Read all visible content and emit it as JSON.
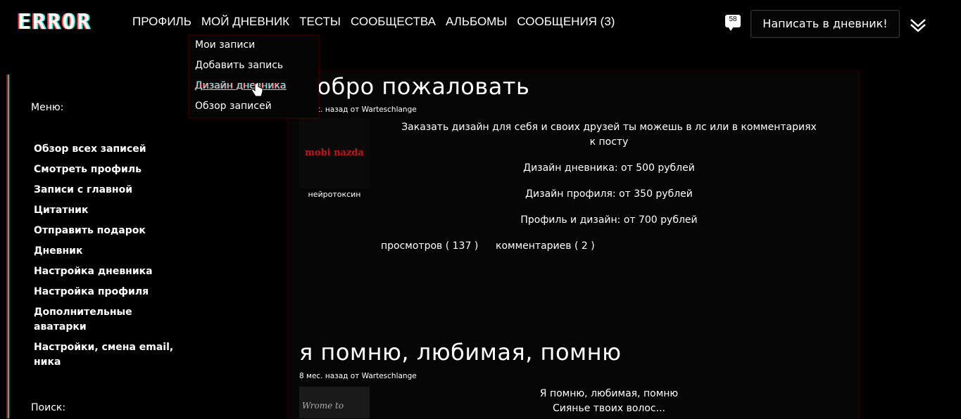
{
  "logo": "ERROR",
  "nav": [
    "ПРОФИЛЬ",
    "МОЙ ДНЕВНИК",
    "ТЕСТЫ",
    "СООБЩЕСТВА",
    "АЛЬБОМЫ",
    "СООБЩЕНИЯ (3)"
  ],
  "notifications_count": "58",
  "write_button": "Написать в дневник!",
  "dropdown": [
    "Мои записи",
    "Добавить запись",
    "Дизайн дневника",
    "Обзор записей"
  ],
  "sidebar": {
    "menu_label": "Меню:",
    "items": [
      "Обзор всех записей",
      "Смотреть профиль",
      "Записи с главной",
      "Цитатник",
      "Отправить подарок",
      "Дневник",
      "Настройка дневника",
      "Настройка профиля",
      "Дополнительные аватарки",
      "Настройки, смена email, ника"
    ],
    "search_label": "Поиск:"
  },
  "posts": [
    {
      "title": "Добро пожаловать",
      "meta": "5 мес. назад от Warteschlange",
      "thumb_text": "mobi nazda",
      "thumb_caption": "нейротоксин",
      "lines": [
        "Заказать дизайн для себя и своих друзей ты можешь в лс или в комментариях к посту",
        "Дизайн дневника: от 500 рублей",
        "Дизайн профиля: от 350 рублей",
        "Профиль и дизайн: от 700 рублей"
      ],
      "views": "просмотров ( 137 )",
      "comments": "комментариев ( 2 )"
    },
    {
      "title": "я помню, любимая, помню",
      "meta": "8 мес. назад от Warteschlange",
      "thumb_text": "Wrome to",
      "lines": [
        "Я помню, любимая, помню",
        "Сиянье твоих волос..."
      ]
    }
  ]
}
